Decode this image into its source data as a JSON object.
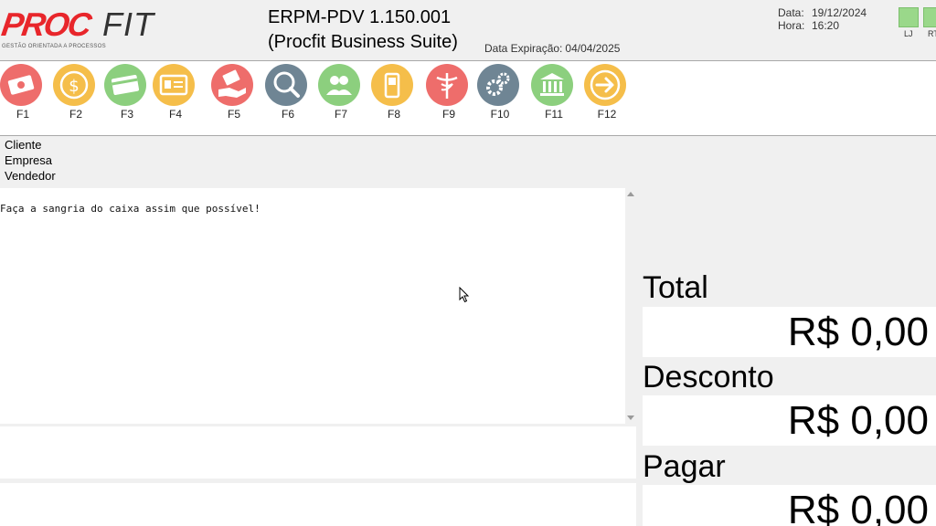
{
  "header": {
    "logo": {
      "part1": "PROC",
      "part2": "FIT",
      "tagline": "GESTÃO ORIENTADA A PROCESSOS"
    },
    "title": "ERPM-PDV 1.150.001",
    "subtitle": "(Procfit Business Suite)",
    "expiry_label": "Data Expiração:",
    "expiry_value": "04/04/2025",
    "date_label": "Data:",
    "date_value": "19/12/2024",
    "time_label": "Hora:",
    "time_value": "16:20",
    "status": [
      {
        "label": "LJ",
        "color": "#9ad88a"
      },
      {
        "label": "RT",
        "color": "#9ad88a"
      }
    ]
  },
  "toolbar": {
    "keys": [
      {
        "label": "F1",
        "icon": "cash-icon",
        "color": "#ee6d6b"
      },
      {
        "label": "F2",
        "icon": "dollar-coin-icon",
        "color": "#f5be4a"
      },
      {
        "label": "F3",
        "icon": "card-icon",
        "color": "#8ccf7e"
      },
      {
        "label": "F4",
        "icon": "id-card-icon",
        "color": "#f5be4a"
      },
      {
        "label": "F5",
        "icon": "hand-card-icon",
        "color": "#ee6d6b"
      },
      {
        "label": "F6",
        "icon": "search-icon",
        "color": "#6f8594"
      },
      {
        "label": "F7",
        "icon": "users-icon",
        "color": "#8ccf7e"
      },
      {
        "label": "F8",
        "icon": "phone-icon",
        "color": "#f5be4a"
      },
      {
        "label": "F9",
        "icon": "caduceus-icon",
        "color": "#ee6d6b"
      },
      {
        "label": "F10",
        "icon": "gears-icon",
        "color": "#6f8594"
      },
      {
        "label": "F11",
        "icon": "bank-icon",
        "color": "#8ccf7e"
      },
      {
        "label": "F12",
        "icon": "arrow-right-icon",
        "color": "#f5be4a"
      }
    ]
  },
  "info": {
    "cliente": "Cliente",
    "empresa": "Empresa",
    "vendedor": "Vendedor"
  },
  "message": "Faça a sangria do caixa assim que possível!",
  "totals": {
    "total_label": "Total",
    "total_value": "R$ 0,00",
    "desconto_label": "Desconto",
    "desconto_value": "R$ 0,00",
    "pagar_label": "Pagar",
    "pagar_value": "R$ 0,00"
  }
}
